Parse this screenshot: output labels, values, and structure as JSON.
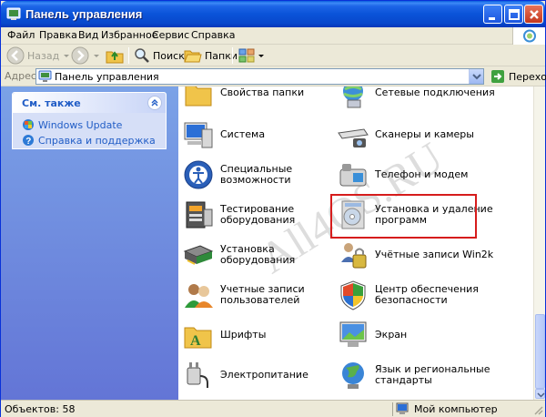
{
  "window": {
    "title": "Панель управления"
  },
  "menu": [
    {
      "label": "Файл"
    },
    {
      "label": "Правка"
    },
    {
      "label": "Вид"
    },
    {
      "label": "Избранное"
    },
    {
      "label": "Сервис"
    },
    {
      "label": "Справка"
    }
  ],
  "toolbar": {
    "back_label": "Назад",
    "search_label": "Поиск",
    "folders_label": "Папки"
  },
  "address": {
    "label": "Адрес:",
    "value": "Панель управления",
    "go_label": "Переход"
  },
  "sidebar": {
    "panel_title": "См. также",
    "links": [
      {
        "label": "Windows Update"
      },
      {
        "label": "Справка и поддержка"
      }
    ]
  },
  "items": [
    {
      "label": "Свойства папки",
      "icon": "folder-options-icon"
    },
    {
      "label": "Сетевые подключения",
      "icon": "network-connections-icon"
    },
    {
      "label": "Система",
      "icon": "system-icon"
    },
    {
      "label": "Сканеры и камеры",
      "icon": "scanners-cameras-icon"
    },
    {
      "label": "Специальные возможности",
      "icon": "accessibility-icon"
    },
    {
      "label": "Телефон и модем",
      "icon": "phone-modem-icon"
    },
    {
      "label": "Тестирование оборудования",
      "icon": "hardware-test-icon"
    },
    {
      "label": "Установка и удаление программ",
      "icon": "add-remove-programs-icon"
    },
    {
      "label": "Установка оборудования",
      "icon": "add-hardware-icon"
    },
    {
      "label": "Учётные записи Win2k",
      "icon": "win2k-accounts-icon"
    },
    {
      "label": "Учетные записи пользователей",
      "icon": "user-accounts-icon"
    },
    {
      "label": "Центр обеспечения безопасности",
      "icon": "security-center-icon"
    },
    {
      "label": "Шрифты",
      "icon": "fonts-icon"
    },
    {
      "label": "Экран",
      "icon": "display-icon"
    },
    {
      "label": "Электропитание",
      "icon": "power-options-icon"
    },
    {
      "label": "Язык и региональные стандарты",
      "icon": "regional-options-icon"
    }
  ],
  "watermark": "All4OS.RU",
  "status": {
    "objects": "Объектов: 58",
    "location": "Мой компьютер"
  },
  "colors": {
    "titlebar": "#0a53d8",
    "sidebar": "#6f8ee0",
    "link": "#215dc6",
    "highlight": "#d61c1c"
  }
}
